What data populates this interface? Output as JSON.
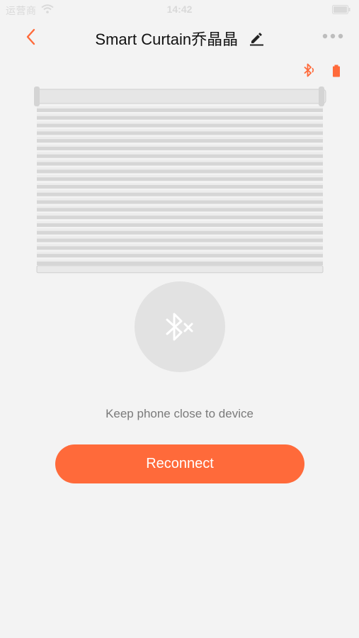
{
  "status_bar": {
    "carrier": "运营商",
    "time": "14:42"
  },
  "header": {
    "title": "Smart Curtain乔晶晶"
  },
  "colors": {
    "accent": "#ff6a3a",
    "background": "#f3f3f3",
    "circle": "#e2e2e2"
  },
  "icons": {
    "back": "chevron-left-icon",
    "edit": "pencil-icon",
    "more": "more-dots-icon",
    "bluetooth_status": "bluetooth-icon",
    "battery_status": "battery-icon",
    "connection": "bluetooth-disconnected-icon"
  },
  "hint": "Keep phone close to device",
  "reconnect_label": "Reconnect"
}
